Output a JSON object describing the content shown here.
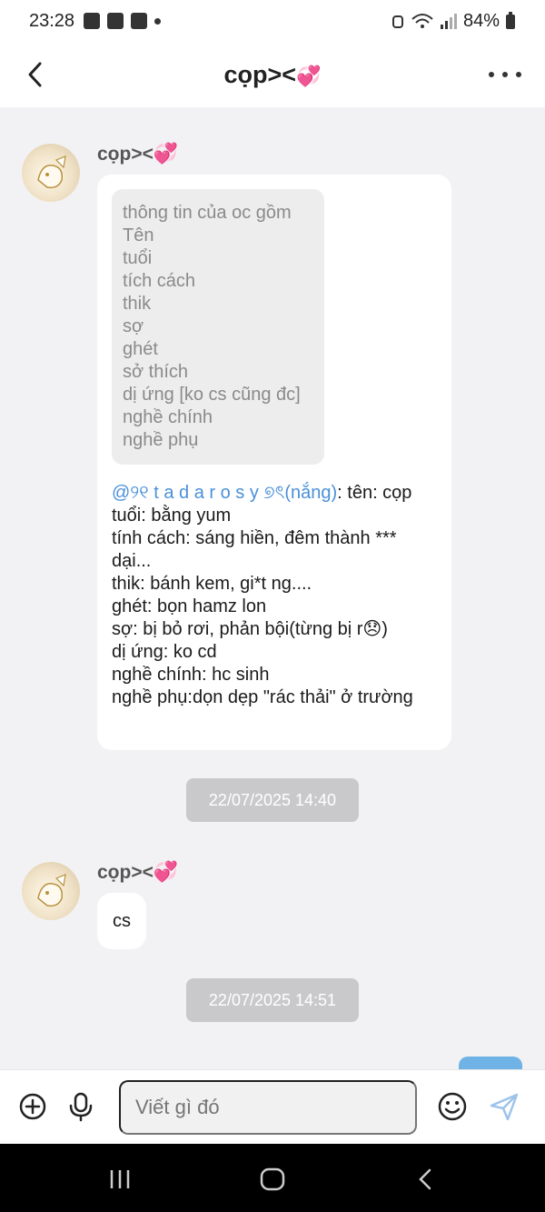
{
  "status_bar": {
    "time": "23:28",
    "battery": "84%"
  },
  "header": {
    "title": "cọp><"
  },
  "messages": [
    {
      "sender": "cọp><",
      "quote_lines": [
        "thông tin của oc gồm",
        "Tên",
        "tuổi",
        "tích cách",
        "thik",
        "sợ",
        "ghét",
        "sở thích",
        "dị ứng [ko cs cũng đc]",
        "nghề chính",
        "nghề phụ"
      ],
      "mention": "@୨୧ t a d a r o s y ୭ৎ(nắng)",
      "body_first": ": tên: cọp",
      "body_lines": [
        "tuổi: bằng yum",
        "tính cách: sáng hiền, đêm thành *** dại...",
        "thik: bánh kem, gi*t ng....",
        "ghét: bọn hamz lon",
        "sợ: bị bỏ rơi, phản bội(từng bị r😞)",
        "dị ứng: ko cd",
        "nghề chính: hc sinh",
        "nghề phụ:dọn dẹp \"rác thải\" ở trường"
      ]
    },
    {
      "timestamp": "22/07/2025 14:40"
    },
    {
      "sender": "cọp><",
      "text": "cs"
    },
    {
      "timestamp": "22/07/2025 14:51"
    }
  ],
  "input": {
    "placeholder": "Viết gì đó"
  },
  "colors": {
    "mention": "#4a90d9",
    "heart": "#ff62a6",
    "timestamp_bg": "#c9c9cb",
    "chat_bg": "#f2f2f4"
  },
  "icons": {
    "back": "chevron-left-icon",
    "more": "more-horizontal-icon",
    "add": "plus-circle-icon",
    "mic": "microphone-icon",
    "emoji": "smiley-icon",
    "send": "send-icon"
  }
}
